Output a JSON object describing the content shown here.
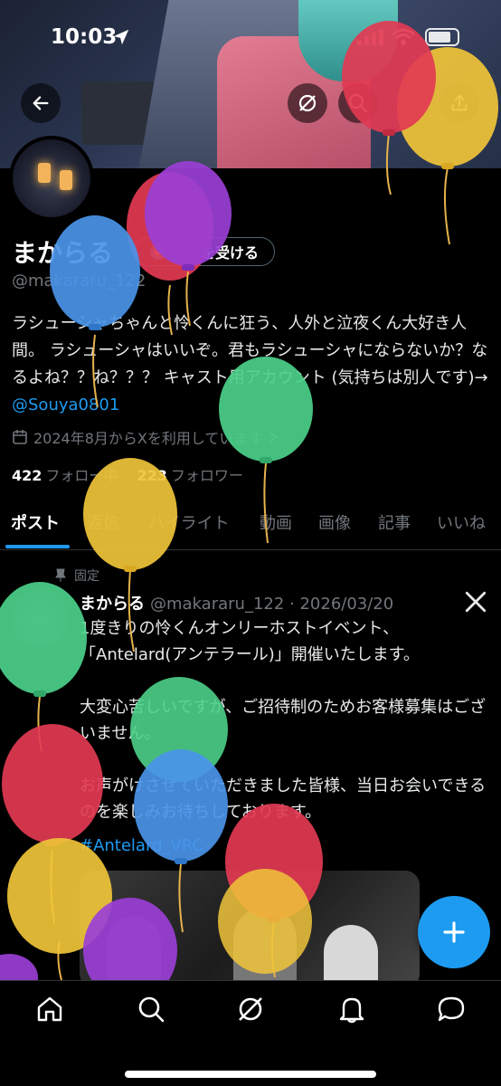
{
  "status_bar": {
    "time": "10:03"
  },
  "profile": {
    "display_name": "まからる",
    "verify_label": "認証を受ける",
    "handle": "@makararu_122",
    "bio_text": "ラシューシャちゃんと怜くんに狂う、人外と泣夜くん大好き人間。 ラシューシャはいいぞ。君もラシューシャにならないか？なるよね？？ね？？？ キャスト用アカウント (気持ちは別人です)→ ",
    "bio_mention": "@Souya0801",
    "joined": "2024年8月からXを利用しています",
    "following_count": "422",
    "following_label": "フォロー中",
    "followers_count": "223",
    "followers_label": "フォロワー"
  },
  "tabs": [
    {
      "label": "ポスト"
    },
    {
      "label": "返信"
    },
    {
      "label": "ハイライト"
    },
    {
      "label": "動画"
    },
    {
      "label": "画像"
    },
    {
      "label": "記事"
    },
    {
      "label": "いいね"
    }
  ],
  "post": {
    "pinned_label": "固定",
    "author": "まからる",
    "meta": "@makararu_122 · 2026/03/20",
    "body": "1度きりの怜くんオンリーホストイベント、\n「Antelard(アンテラール)」開催いたします。\n\n大変心苦しいですが、ご招待制のためお客様募集はございません。\n\nお声がけさせていただきました皆様、当日お会いできるのを楽しみお待ちしております。",
    "hashtag": "#Antelard_VRC"
  },
  "icons": {
    "back": "back-arrow-icon",
    "grok": "grok-icon",
    "search": "search-icon",
    "share": "share-icon",
    "compose": "plus-icon"
  },
  "colors": {
    "accent": "#1d9bf0",
    "balloon_red": "#e23a52",
    "balloon_yellow": "#f0c43a",
    "balloon_blue": "#4a94e8",
    "balloon_green": "#4cd08a",
    "balloon_purple": "#9a3fd6"
  }
}
